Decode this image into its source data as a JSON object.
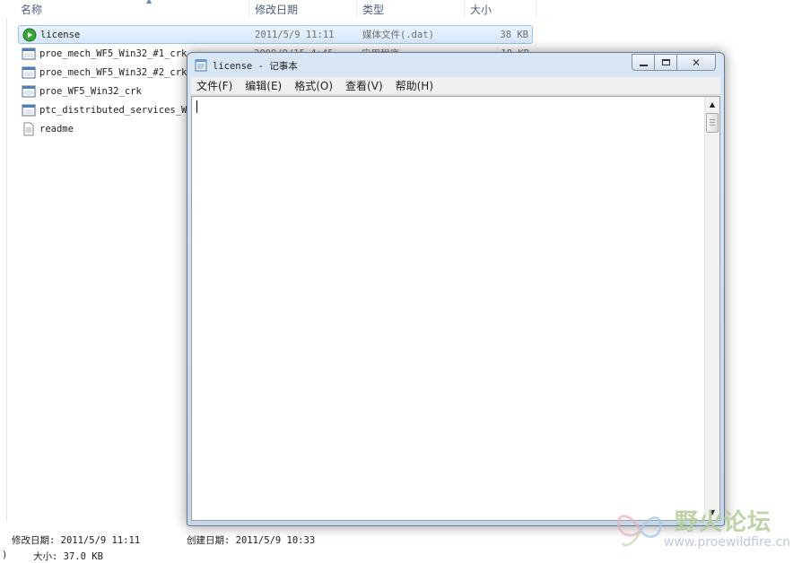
{
  "explorer": {
    "columns": {
      "name": "名称",
      "modified": "修改日期",
      "type": "类型",
      "size": "大小"
    },
    "files": [
      {
        "name": "license",
        "date": "2011/5/9 11:11",
        "type": "媒体文件(.dat)",
        "size": "38 KB",
        "icon": "media-file-icon",
        "selected": true
      },
      {
        "name": "proe_mech_WF5_Win32_#1_crk",
        "date": "2009/9/15 4:45",
        "type": "应用程序",
        "size": "18 KB",
        "icon": "application-icon",
        "selected": false
      },
      {
        "name": "proe_mech_WF5_Win32_#2_crk",
        "date": "",
        "type": "",
        "size": "",
        "icon": "application-icon",
        "selected": false
      },
      {
        "name": "proe_WF5_Win32_crk",
        "date": "",
        "type": "",
        "size": "",
        "icon": "application-icon",
        "selected": false
      },
      {
        "name": "ptc_distributed_services_WF5",
        "date": "",
        "type": "",
        "size": "",
        "icon": "application-icon",
        "selected": false
      },
      {
        "name": "readme",
        "date": "",
        "type": "",
        "size": "",
        "icon": "text-document-icon",
        "selected": false
      }
    ],
    "status": {
      "modified": "修改日期: 2011/5/9 11:11",
      "created": "创建日期: 2011/5/9 10:33",
      "size": "大小: 37.0 KB",
      "left_paren": ")"
    }
  },
  "notepad": {
    "title": "license - 记事本",
    "menu": [
      "文件(F)",
      "编辑(E)",
      "格式(O)",
      "查看(V)",
      "帮助(H)"
    ],
    "content": ""
  },
  "watermark": {
    "title": "野火论坛",
    "url": "www.proewildfire.cn"
  },
  "colors": {
    "selection": "#d6e8fb",
    "window_frame": "#c6d7ea",
    "header_text": "#4c607a"
  }
}
